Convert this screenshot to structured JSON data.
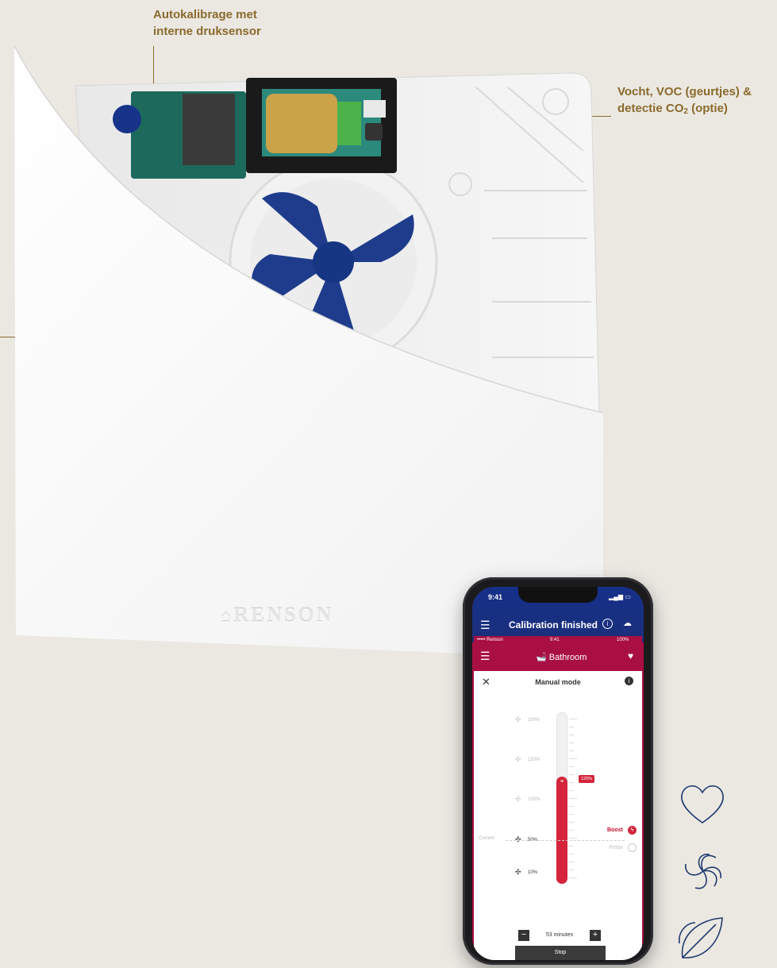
{
  "annotations": {
    "calibration_line1": "Autokalibrage met",
    "calibration_line2": "interne druksensor",
    "sensor_line1": "Vocht, VOC (geurtjes) &",
    "sensor_line2_prefix": "detectie CO",
    "sensor_line2_sub": "2",
    "sensor_line2_suffix": " (optie)"
  },
  "brand": {
    "name": "RENSON"
  },
  "phone": {
    "status_time": "9:41",
    "calibration_title": "Calibration finished",
    "inner_status": {
      "carrier": "••••• Renson",
      "time": "9:41",
      "battery": "100%"
    },
    "room": "Bathroom",
    "mode_title": "Manual mode",
    "levels": [
      "200%",
      "150%",
      "100%",
      "50%",
      "10%"
    ],
    "current_label": "Current",
    "current_value": "125%",
    "slider_value_percent": 125,
    "boost_label": "Boost",
    "relax_label": "Relax",
    "duration": "53 minutes",
    "stop_label": "Stop",
    "minus": "−",
    "plus": "+"
  },
  "colors": {
    "annotation": "#8a6a2c",
    "app_header": "#a90f43",
    "calibration_bar": "#1b2f7a",
    "slider_fill": "#d4253c",
    "icons_stroke": "#1f3a6e"
  },
  "side_icons": [
    "heart-icon",
    "air-swirl-icon",
    "leaf-icon"
  ]
}
